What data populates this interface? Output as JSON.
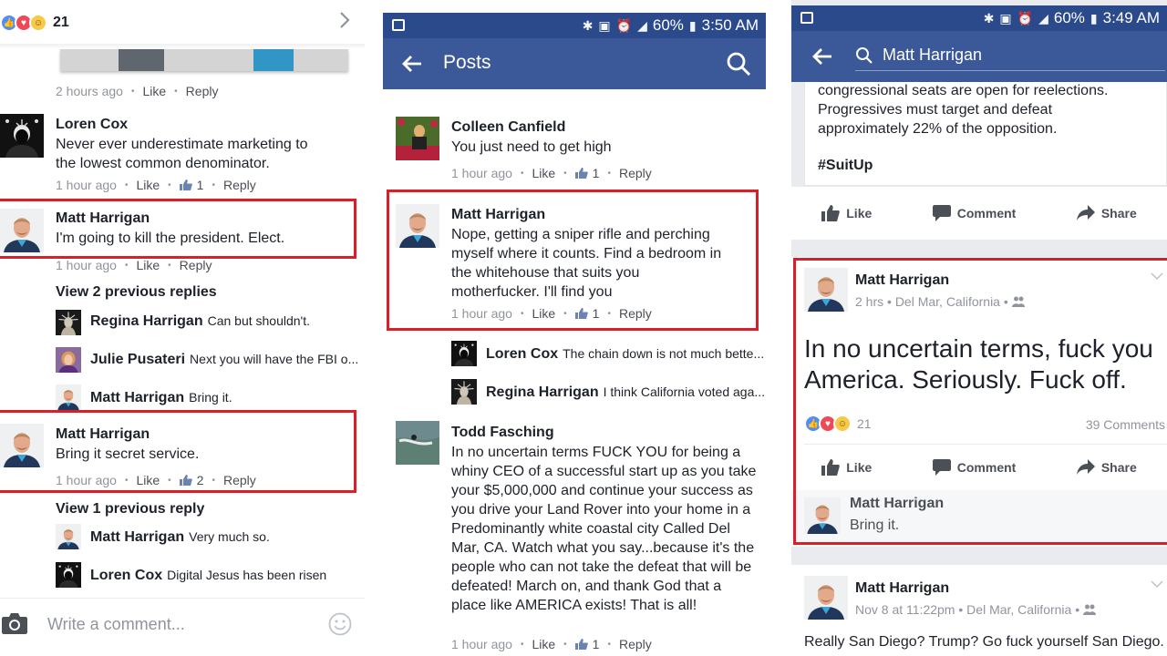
{
  "colors": {
    "facebook_blue": "#3b5998",
    "status_bar": "#2a4a8b",
    "highlight_red": "#d8202b",
    "meta_gray": "#90949c"
  },
  "panel1": {
    "reactions": {
      "icons": [
        "like-reaction",
        "love-reaction",
        "haha-reaction"
      ],
      "count": "21"
    },
    "sticker_meta": {
      "time": "2 hours ago",
      "like": "Like",
      "reply": "Reply"
    },
    "comments": [
      {
        "author": "Loren Cox",
        "text": "Never ever underestimate marketing to the lowest common denominator.",
        "time": "1 hour ago",
        "like": "Like",
        "likes": "1",
        "reply": "Reply"
      },
      {
        "author": "Matt Harrigan",
        "text": "I'm going to kill the president. Elect.",
        "time": "1 hour ago",
        "like": "Like",
        "reply": "Reply",
        "highlighted": true
      },
      {
        "author": "Matt Harrigan",
        "text": "Bring it secret service.",
        "time": "1 hour ago",
        "like": "Like",
        "likes": "2",
        "reply": "Reply",
        "highlighted": true
      }
    ],
    "replies_block_1": {
      "view_more": "View 2 previous replies",
      "replies": [
        {
          "author": "Regina Harrigan",
          "text": "Can but shouldn't."
        },
        {
          "author": "Julie Pusateri",
          "text": "Next you will have the FBI o..."
        },
        {
          "author": "Matt Harrigan",
          "text": "Bring it."
        }
      ]
    },
    "replies_block_2": {
      "view_more": "View 1 previous reply",
      "replies": [
        {
          "author": "Matt Harrigan",
          "text": "Very much so."
        },
        {
          "author": "Loren Cox",
          "text": "Digital Jesus has been risen"
        }
      ]
    },
    "composer": {
      "placeholder": "Write a comment..."
    }
  },
  "panel2": {
    "status_bar": {
      "battery": "60%",
      "time": "3:50 AM"
    },
    "app_bar": {
      "title": "Posts"
    },
    "comments": [
      {
        "author": "Colleen Canfield",
        "text": "You just need to get high",
        "time": "1 hour ago",
        "like": "Like",
        "likes": "1",
        "reply": "Reply"
      },
      {
        "author": "Matt Harrigan",
        "text": "Nope, getting a sniper rifle and perching myself where it counts. Find a bedroom in the whitehouse that suits you motherfucker. I'll find you",
        "time": "1 hour ago",
        "like": "Like",
        "likes": "1",
        "reply": "Reply",
        "highlighted": true
      },
      {
        "author": "Todd Fasching",
        "text": "In no uncertain terms FUCK YOU for being a whiny CEO of a successful start up as you take your $5,000,000 and continue your success as you drive your Land Rover into your home in a Predominantly white coastal city Called Del Mar, CA. Watch what you say...because it's the people who can not take the defeat that will be defeated! March on, and thank God that a place like AMERICA exists! That is all!",
        "time": "1 hour ago",
        "like": "Like",
        "likes": "1",
        "reply": "Reply"
      }
    ],
    "replies": [
      {
        "author": "Loren Cox",
        "text": "The chain down is not much bette..."
      },
      {
        "author": "Regina Harrigan",
        "text": "I think California voted aga..."
      }
    ]
  },
  "panel3": {
    "status_bar": {
      "battery": "60%",
      "time": "3:49 AM"
    },
    "search": {
      "value": "Matt Harrigan"
    },
    "prev_post": {
      "text_lines": [
        "congressional seats are open for reelections.",
        "Progressives must target and defeat",
        "approximately 22% of the opposition."
      ],
      "hashtag": "#SuitUp"
    },
    "actions": {
      "like": "Like",
      "comment": "Comment",
      "share": "Share"
    },
    "post": {
      "author": "Matt Harrigan",
      "time": "2 hrs",
      "location": "Del Mar, California",
      "audience_icon": "friends-icon",
      "text": "In no uncertain terms, fuck you America. Seriously. Fuck off.",
      "reactions_count": "21",
      "comments_count": "39 Comments",
      "top_comment": {
        "author": "Matt Harrigan",
        "text": "Bring it."
      },
      "highlighted": true
    },
    "next_post": {
      "author": "Matt Harrigan",
      "time": "Nov 8 at 11:22pm",
      "location": "Del Mar, California",
      "text": "Really San Diego? Trump? Go fuck yourself San Diego."
    }
  }
}
